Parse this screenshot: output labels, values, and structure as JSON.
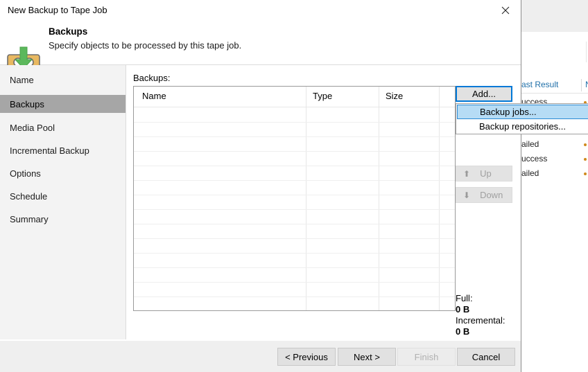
{
  "dialog": {
    "title": "New Backup to Tape Job",
    "close_icon": "close-icon",
    "header": {
      "title": "Backups",
      "subtitle": "Specify objects to be processed by this tape job.",
      "icon": "tape-backup-icon"
    },
    "sidebar": {
      "items": [
        {
          "label": "Name",
          "active": false
        },
        {
          "label": "Backups",
          "active": true
        },
        {
          "label": "Media Pool",
          "active": false
        },
        {
          "label": "Incremental Backup",
          "active": false
        },
        {
          "label": "Options",
          "active": false
        },
        {
          "label": "Schedule",
          "active": false
        },
        {
          "label": "Summary",
          "active": false
        }
      ]
    },
    "main": {
      "list_label": "Backups:",
      "columns": [
        "Name",
        "Type",
        "Size"
      ],
      "rows": [],
      "add_button": "Add...",
      "add_menu": [
        {
          "label": "Backup jobs...",
          "selected": true
        },
        {
          "label": "Backup repositories...",
          "selected": false
        }
      ],
      "up_button": "Up",
      "down_button": "Down",
      "up_icon": "arrow-up-icon",
      "down_icon": "arrow-down-icon",
      "summary": {
        "full_label": "Full:",
        "full_value": "0 B",
        "incremental_label": "Incremental:",
        "incremental_value": "0 B"
      }
    },
    "footer": {
      "previous": "< Previous",
      "next": "Next >",
      "finish": "Finish",
      "cancel": "Cancel"
    }
  },
  "background": {
    "column_header": "ast Result",
    "rows": [
      {
        "value": "uccess",
        "dot": ""
      },
      {
        "value": "ailed",
        "dot": "#d08a1e"
      },
      {
        "value": "uccess",
        "dot": "#d08a1e"
      },
      {
        "value": "ailed",
        "dot": ""
      }
    ]
  },
  "colors": {
    "accent": "#0078d7",
    "menu_highlight": "#b6dcf5",
    "sidebar_active": "#a6a6a6",
    "header_link": "#1f6fa8"
  }
}
